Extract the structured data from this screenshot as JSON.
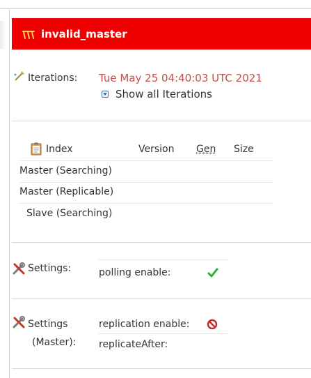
{
  "core": {
    "name": "invalid_master"
  },
  "iterations": {
    "label": "Iterations:",
    "timestamp": "Tue May 25 04:40:03 UTC 2021",
    "show_all": "Show all Iterations"
  },
  "index_table": {
    "headers": [
      "Index",
      "Version",
      "Gen",
      "Size"
    ],
    "rows": [
      "Master (Searching)",
      "Master (Replicable)",
      "Slave (Searching)"
    ]
  },
  "settings": {
    "label": "Settings:",
    "polling_label": "polling enable:",
    "polling_status": "enabled"
  },
  "master_settings": {
    "label_line1": "Settings",
    "label_line2": "(Master):",
    "replication_label": "replication enable:",
    "replication_status": "disabled",
    "replicate_after_label": "replicateAfter:"
  },
  "colors": {
    "banner": "#ee0000",
    "timestamp": "#c0504d",
    "check": "#2eae2e",
    "disabled": "#cc2a2a"
  },
  "icons": [
    "core-icon",
    "iterations-icon",
    "clipboard-icon",
    "chevron-down-icon",
    "tools-icon",
    "check-icon",
    "no-entry-icon"
  ]
}
